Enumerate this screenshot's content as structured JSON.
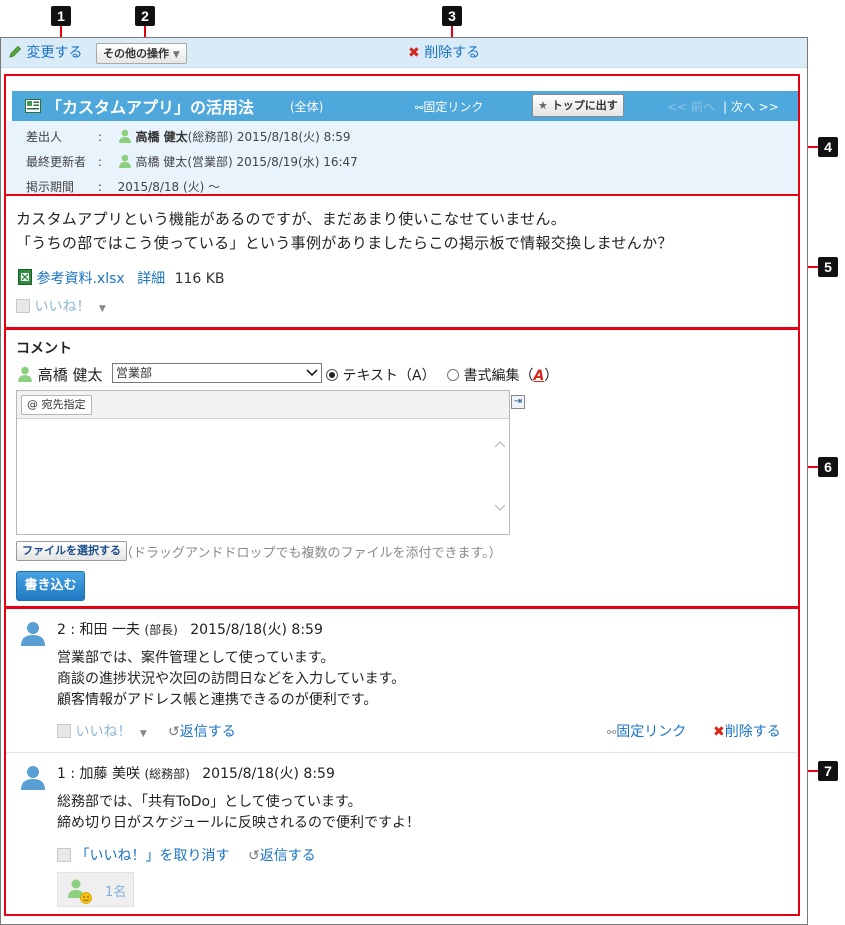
{
  "callouts": [
    "1",
    "2",
    "3",
    "4",
    "5",
    "6",
    "7"
  ],
  "toolbar": {
    "edit_label": "変更する",
    "other_ops_label": "その他の操作",
    "delete_label": "削除する"
  },
  "message": {
    "title": "「カスタムアプリ」の活用法",
    "scope": "(全体)",
    "permalink_label": "固定リンク",
    "pin_top_label": "トップに出す",
    "prev_label": "<< 前へ",
    "next_label": "| 次へ >>",
    "sender_label": "差出人",
    "sender_name": "高橋 健太",
    "sender_org": "(総務部)",
    "sender_date": "2015/8/18(火) 8:59",
    "updater_label": "最終更新者",
    "updater_name": "高橋 健太",
    "updater_org": "(営業部)",
    "updater_date": "2015/8/19(水) 16:47",
    "period_label": "掲示期間",
    "period_value": "2015/8/18 (火) ～",
    "colon": ":",
    "body_line1": "カスタムアプリという機能があるのですが、まだあまり使いこなせていません。",
    "body_line2": "「うちの部ではこう使っている」という事例がありましたらこの掲示板で情報交換しませんか？",
    "attachment_name": "参考資料.xlsx",
    "attachment_detail": "詳細",
    "attachment_size": "116 KB",
    "like_label": "いいね！"
  },
  "comment_form": {
    "heading": "コメント",
    "user_name": "高橋 健太",
    "org_selected": "営業部",
    "mode_text_label": "テキスト（A）",
    "mode_rich_label": "書式編集（",
    "mode_rich_letter": "A",
    "mode_rich_close": "）",
    "mention_label": "@ 宛先指定",
    "file_button": "ファイルを選択する",
    "file_hint": "（ドラッグアンドドロップでも複数のファイルを添付できます。）",
    "submit": "書き込む"
  },
  "comments": [
    {
      "number_name": "2 : 和田 一夫",
      "role": "(部長)",
      "date": "2015/8/18(火) 8:59",
      "lines": [
        "営業部では、案件管理として使っています。",
        "商談の進捗状況や次回の訪問日などを入力しています。",
        "顧客情報がアドレス帳と連携できるのが便利です。"
      ],
      "like_label": "いいね！",
      "reply_label": "返信する",
      "permalink_label": "固定リンク",
      "delete_label": "削除する"
    },
    {
      "number_name": "1 : 加藤 美咲",
      "role": "(総務部)",
      "date": "2015/8/18(火) 8:59",
      "lines": [
        "総務部では、「共有ToDo」として使っています。",
        "締め切り日がスケジュールに反映されるので便利ですよ！"
      ],
      "unlike_label": "「いいね！」を取り消す",
      "reply_label": "返信する",
      "like_count": "1名"
    }
  ],
  "colors": {
    "accent_red": "#e60012",
    "title_bar": "#4ea8db",
    "toolbar_bg": "#d9ebf7",
    "link_blue": "#1a73c6"
  }
}
